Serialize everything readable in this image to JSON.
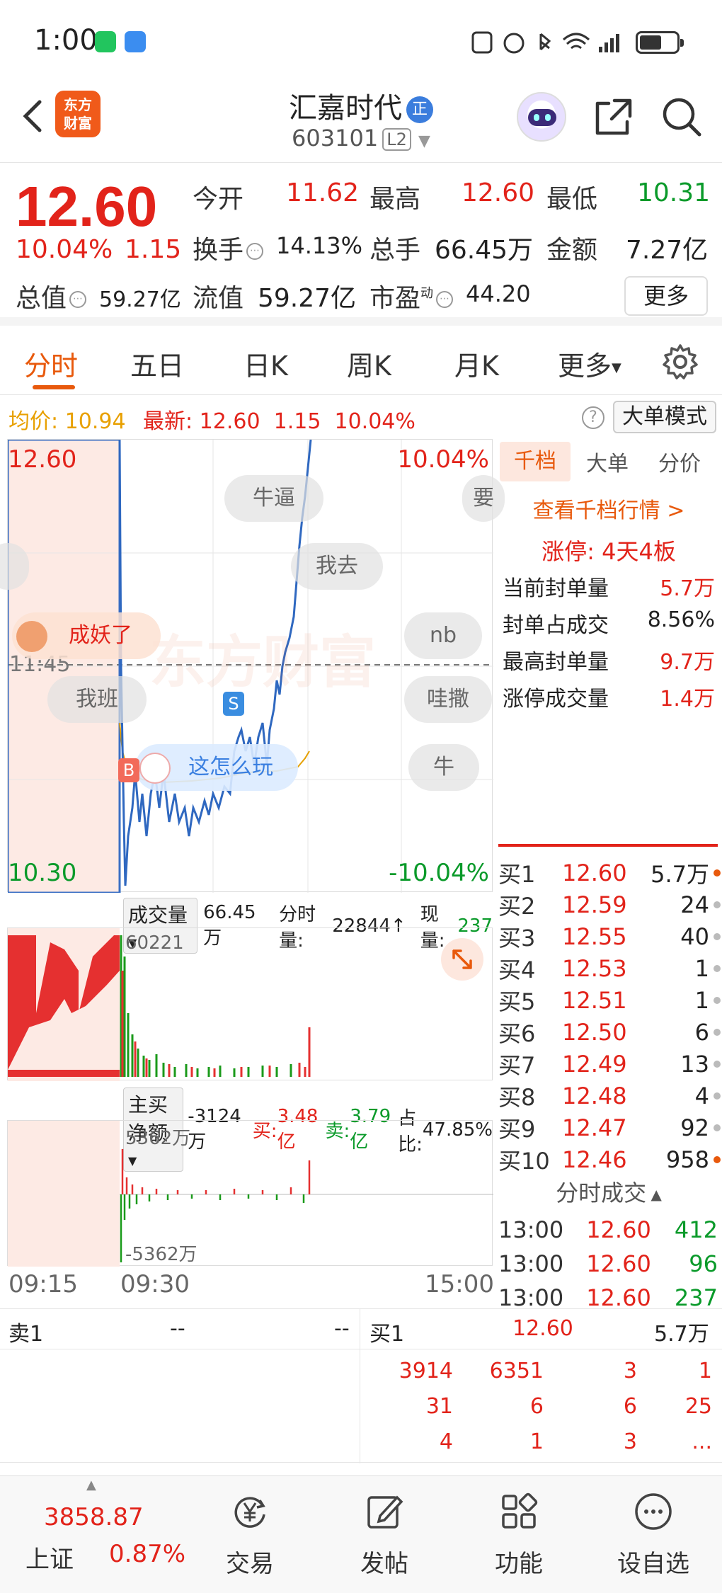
{
  "status_bar": {
    "time": "1:00"
  },
  "header": {
    "logo_line1": "东方",
    "logo_line2": "财富",
    "stock_name": "汇嘉时代",
    "name_badge": "正",
    "stock_code": "603101",
    "level": "L2"
  },
  "quote": {
    "price": "12.60",
    "change_pct": "10.04%",
    "change": "1.15",
    "open_label": "今开",
    "open": "11.62",
    "high_label": "最高",
    "high": "12.60",
    "low_label": "最低",
    "low": "10.31",
    "turnover_label": "换手",
    "turnover": "14.13%",
    "volume_label": "总手",
    "volume": "66.45万",
    "amount_label": "金额",
    "amount": "7.27亿",
    "mktcap_label": "总值",
    "mktcap": "59.27亿",
    "float_label": "流值",
    "float": "59.27亿",
    "pe_label": "市盈",
    "pe_sup": "动",
    "pe": "44.20",
    "more": "更多"
  },
  "tabs": [
    "分时",
    "五日",
    "日K",
    "周K",
    "月K",
    "更多"
  ],
  "strip": {
    "avg_label": "均价:",
    "avg": "10.94",
    "latest_label": "最新:",
    "latest": "12.60",
    "chg": "1.15",
    "pct": "10.04%",
    "help": "?",
    "big_order_mode": "大单模式"
  },
  "chart": {
    "price_top": "12.60",
    "price_bottom": "10.30",
    "pct_top": "10.04%",
    "pct_bottom": "-10.04%",
    "time_marker": "11:45",
    "bullets": [
      "牛逼",
      "我去",
      "nb",
      "我班",
      "哇撒",
      "牛",
      "成妖了",
      "这怎么玩",
      "要"
    ],
    "marker_b": "B",
    "marker_s": "S",
    "watermark": "东方财富"
  },
  "volume": {
    "selector": "成交量",
    "total": "66.45万",
    "fen_label": "分时量:",
    "fen": "22844",
    "now_label": "现量:",
    "now": "237",
    "max": "60221"
  },
  "flow": {
    "selector": "主买净额",
    "net": "-3124万",
    "buy_label": "买:",
    "buy": "3.48亿",
    "sell_label": "卖:",
    "sell": "3.79亿",
    "ratio_label": "占比:",
    "ratio": "47.85%",
    "top": "5362万",
    "bottom": "-5362万"
  },
  "time_axis": [
    "09:15",
    "09:30",
    "15:00"
  ],
  "right_panel": {
    "tabs": [
      "千档",
      "大单",
      "分价"
    ],
    "link": "查看千档行情 >",
    "limit_up": "涨停:  4天4板",
    "stats": [
      {
        "label": "当前封单量",
        "value": "5.7万",
        "color": "#e2231a"
      },
      {
        "label": "封单占成交",
        "value": "8.56%",
        "color": "#222222"
      },
      {
        "label": "最高封单量",
        "value": "9.7万",
        "color": "#e2231a"
      },
      {
        "label": "涨停成交量",
        "value": "1.4万",
        "color": "#e2231a"
      }
    ],
    "bids": [
      {
        "label": "买1",
        "price": "12.60",
        "vol": "5.7万",
        "hot": true
      },
      {
        "label": "买2",
        "price": "12.59",
        "vol": "24",
        "hot": false
      },
      {
        "label": "买3",
        "price": "12.55",
        "vol": "40",
        "hot": false
      },
      {
        "label": "买4",
        "price": "12.53",
        "vol": "1",
        "hot": false
      },
      {
        "label": "买5",
        "price": "12.51",
        "vol": "1",
        "hot": false
      },
      {
        "label": "买6",
        "price": "12.50",
        "vol": "6",
        "hot": false
      },
      {
        "label": "买7",
        "price": "12.49",
        "vol": "13",
        "hot": false
      },
      {
        "label": "买8",
        "price": "12.48",
        "vol": "4",
        "hot": false
      },
      {
        "label": "买9",
        "price": "12.47",
        "vol": "92",
        "hot": false
      },
      {
        "label": "买10",
        "price": "12.46",
        "vol": "958",
        "hot": true
      }
    ],
    "ticks_title": "分时成交",
    "ticks": [
      {
        "time": "13:00",
        "price": "12.60",
        "vol": "412"
      },
      {
        "time": "13:00",
        "price": "12.60",
        "vol": "96"
      },
      {
        "time": "13:00",
        "price": "12.60",
        "vol": "237"
      }
    ]
  },
  "order_table": {
    "sell_label": "卖1",
    "sell_p": "--",
    "sell_v": "--",
    "buy_label": "买1",
    "buy_p": "12.60",
    "buy_v": "5.7万",
    "queue": [
      [
        "3914",
        "6351",
        "3",
        "1"
      ],
      [
        "31",
        "6",
        "6",
        "25"
      ],
      [
        "4",
        "1",
        "3",
        "..."
      ]
    ]
  },
  "nav": {
    "index_value": "3858.87",
    "index_name": "上证",
    "index_pct": "0.87%",
    "items": [
      "交易",
      "发帖",
      "功能",
      "设自选"
    ]
  },
  "colors": {
    "up": "#e2231a",
    "down": "#0a9a2a",
    "accent": "#e8590c"
  }
}
